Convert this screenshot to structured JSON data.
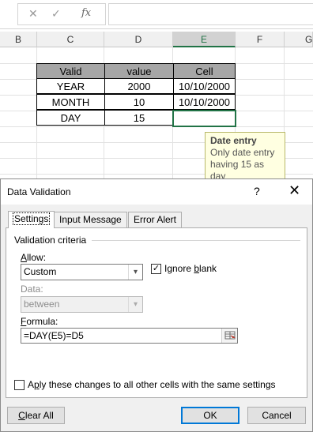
{
  "formula_bar": {
    "cancel_icon": "close-icon",
    "enter_icon": "check-icon",
    "function_label": "fx",
    "formula_value": ""
  },
  "columns": [
    "B",
    "C",
    "D",
    "E",
    "F",
    "G"
  ],
  "selected_column": "E",
  "table": {
    "headers": [
      "Valid",
      "value",
      "Cell"
    ],
    "rows": [
      [
        "YEAR",
        "2000",
        "10/10/2000"
      ],
      [
        "MONTH",
        "10",
        "10/10/2000"
      ],
      [
        "DAY",
        "15",
        ""
      ]
    ]
  },
  "tooltip": {
    "title": "Date entry",
    "body_line1": "Only date entry",
    "body_line2": "having 15 as",
    "body_line3": "day"
  },
  "dialog": {
    "title": "Data Validation",
    "help": "?",
    "close": "✕",
    "tabs": [
      "Settings",
      "Input Message",
      "Error Alert"
    ],
    "active_tab": "Settings",
    "group_label": "Validation criteria",
    "allow_label_accel": "A",
    "allow_label_rest": "llow:",
    "allow_value": "Custom",
    "ignore_blank_accel": "b",
    "ignore_blank_prefix": "Ignore ",
    "ignore_blank_rest": "lank",
    "ignore_blank_checked": true,
    "data_label": "Data:",
    "data_value": "between",
    "formula_label_accel": "F",
    "formula_label_rest": "ormula:",
    "formula_value": "=DAY(E5)=D5",
    "apply_prefix": "Ap",
    "apply_accel": "p",
    "apply_rest": "ly these changes to all other cells with the same settings",
    "apply_checked": false,
    "clear_all_accel": "C",
    "clear_all_rest": "lear All",
    "ok_label": "OK",
    "cancel_label": "Cancel",
    "accent_color": "#0078d7"
  },
  "colors": {
    "table_header_bg": "#a6a6a6",
    "selection_green": "#217346",
    "tooltip_bg": "#ffffe1"
  }
}
